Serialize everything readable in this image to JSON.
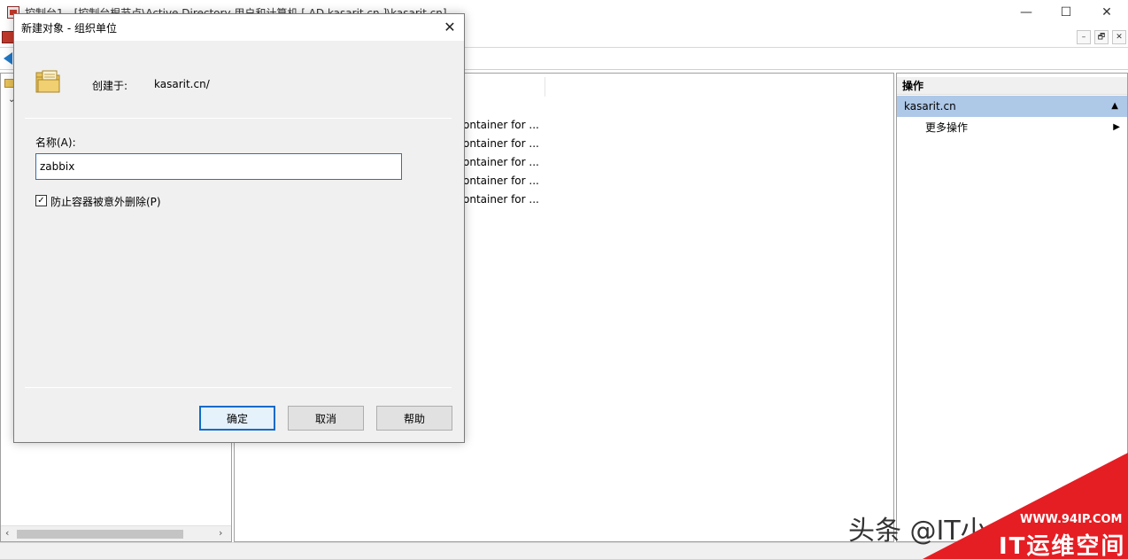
{
  "window": {
    "title": "控制台1 - [控制台根节点\\Active Directory 用户和计算机 [ AD.kasarit.cn ]\\kasarit.cn]",
    "minimize": "—",
    "maximize": "☐",
    "close": "✕"
  },
  "mdi_controls": {
    "minimize": "–",
    "restore": "🗗",
    "close": "✕"
  },
  "center": {
    "rows": [
      "ontainer for ...",
      "ontainer for ...",
      "ontainer for ...",
      "ontainer for ...",
      "ontainer for ..."
    ]
  },
  "actions_pane": {
    "header": "操作",
    "group": "kasarit.cn",
    "items": [
      "更多操作"
    ]
  },
  "dialog": {
    "title": "新建对象 - 组织单位",
    "created_in_label": "创建于:",
    "created_in_value": "kasarit.cn/",
    "name_label": "名称(A):",
    "name_value": "zabbix",
    "protect_label": "防止容器被意外删除(P)",
    "protect_checked": true,
    "ok_label": "确定",
    "cancel_label": "取消",
    "help_label": "帮助"
  },
  "watermark": {
    "text": "头条 @IT小",
    "url": "WWW.94IP.COM",
    "brand": "IT运维空间"
  }
}
